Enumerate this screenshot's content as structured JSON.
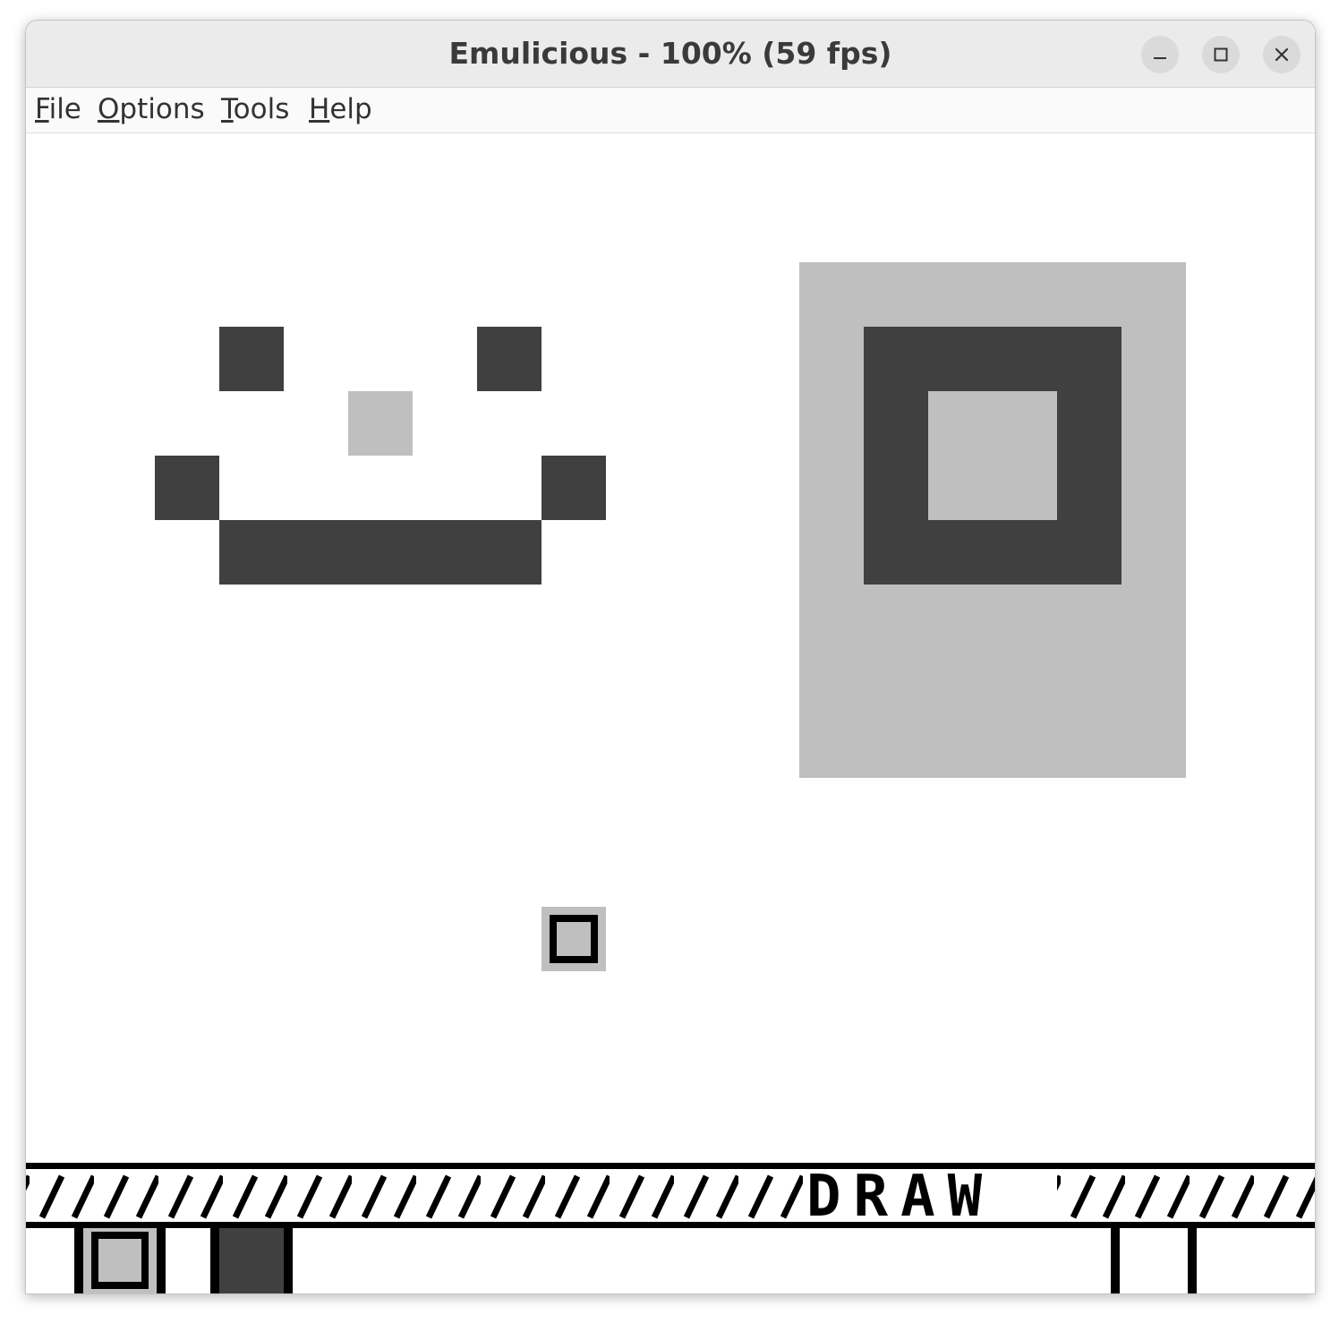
{
  "window": {
    "title": "Emulicious - 100% (59 fps)",
    "controls": [
      "minimize",
      "maximize",
      "close"
    ]
  },
  "menu": {
    "items": [
      {
        "mnemonic": "F",
        "rest": "ile"
      },
      {
        "mnemonic": "O",
        "rest": "ptions"
      },
      {
        "mnemonic": "T",
        "rest": "ools"
      },
      {
        "mnemonic": "H",
        "rest": "elp"
      }
    ]
  },
  "game": {
    "palette": {
      "white": "#ffffff",
      "light": "#bfbfbf",
      "dark": "#404040",
      "black": "#000000"
    },
    "hud": {
      "mode_label": "DRAW"
    }
  }
}
